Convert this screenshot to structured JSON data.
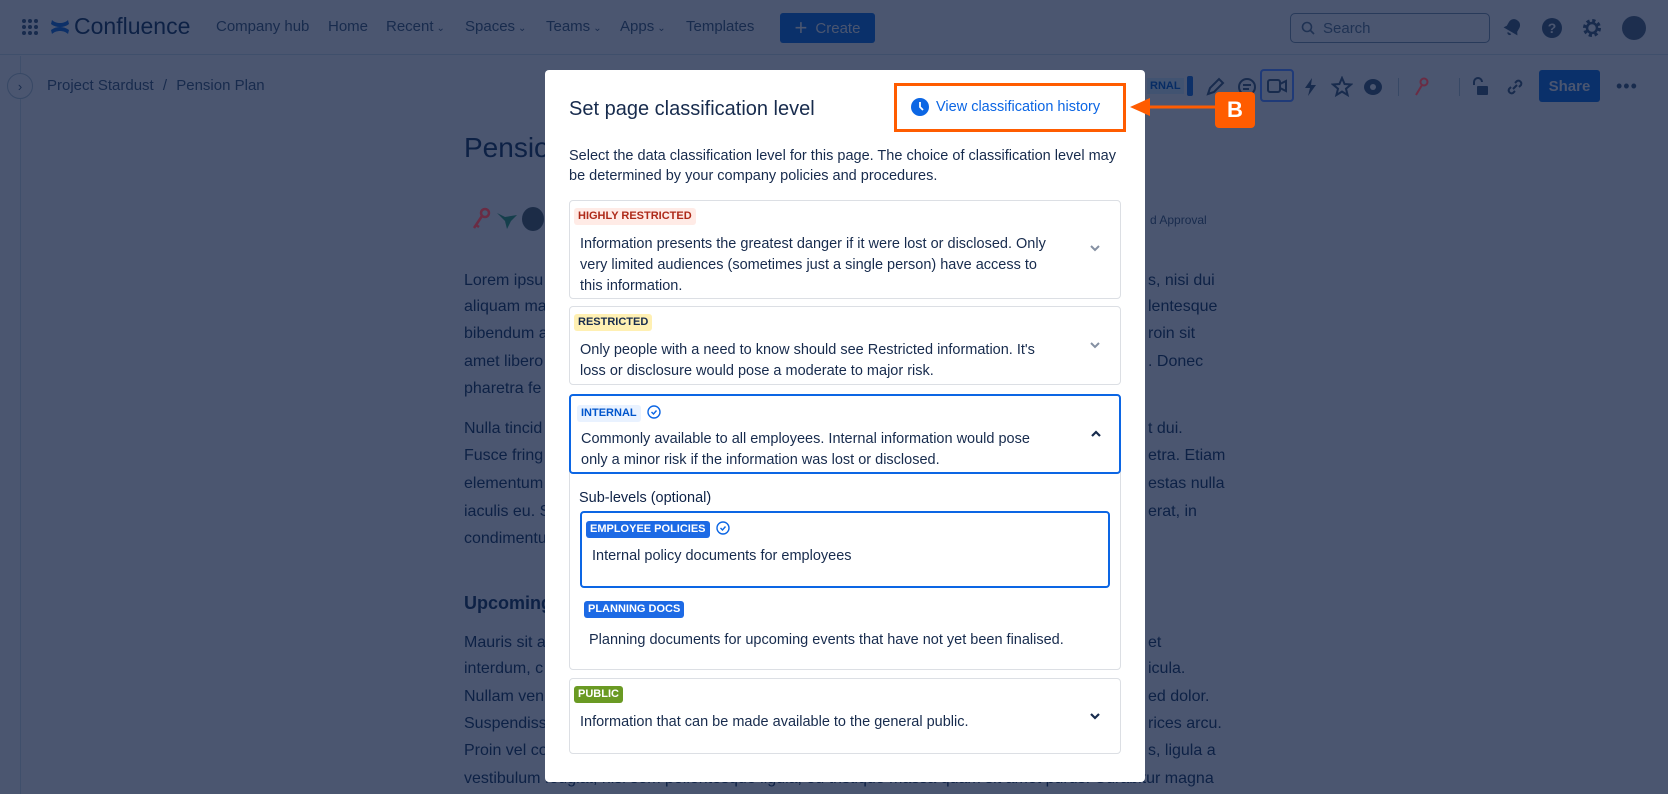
{
  "nav": {
    "app_name": "Confluence",
    "items": [
      {
        "label": "Company hub",
        "dropdown": false
      },
      {
        "label": "Home",
        "dropdown": false
      },
      {
        "label": "Recent",
        "dropdown": true
      },
      {
        "label": "Spaces",
        "dropdown": true
      },
      {
        "label": "Teams",
        "dropdown": true
      },
      {
        "label": "Apps",
        "dropdown": true
      },
      {
        "label": "Templates",
        "dropdown": false
      }
    ],
    "create_label": "Create",
    "search_placeholder": "Search"
  },
  "breadcrumb": {
    "space": "Project Stardust",
    "separator": "/",
    "page": "Pension Plan"
  },
  "toolbar": {
    "classification_fragment": "RNAL",
    "share_label": "Share"
  },
  "page": {
    "title_fragment": "Pensio",
    "byline_fragment": "d Approval",
    "heading_fragment": "Upcoming",
    "lines": [
      {
        "left": "Lorem ipsu",
        "right": "s, nisi dui"
      },
      {
        "left": "aliquam ma",
        "right": "lentesque"
      },
      {
        "left": "bibendum a",
        "right": "roin sit"
      },
      {
        "left": "amet libero",
        "right": ". Donec"
      },
      {
        "left": "pharetra fe",
        "right": ""
      },
      {
        "left": "Nulla tincid",
        "right": "t dui."
      },
      {
        "left": "Fusce fring",
        "right": "etra. Etiam"
      },
      {
        "left": "elementum",
        "right": "estas nulla"
      },
      {
        "left": "iaculis eu. S",
        "right": "erat, in"
      },
      {
        "left": "condimentu",
        "right": ""
      },
      {
        "left": "Mauris sit a",
        "right": "et"
      },
      {
        "left": "interdum, c",
        "right": "icula."
      },
      {
        "left": "Nullam ven",
        "right": "ed dolor."
      },
      {
        "left": "Suspendiss",
        "right": "rices arcu."
      },
      {
        "left": "Proin vel co",
        "right": "s, ligula a"
      },
      {
        "left": "vestibulum feugiat, nisi sem pellentesque ligula, eu tristique massa quam sit amet purus. Curabitur magna",
        "right": ""
      }
    ]
  },
  "modal": {
    "title": "Set page classification level",
    "history_link": "View classification history",
    "description": "Select the data classification level for this page. The choice of classification level may be determined by your company policies and procedures.",
    "levels": [
      {
        "label": "Highly restricted",
        "description": "Information presents the greatest danger if it were lost or disclosed. Only very limited audiences (sometimes just a single person) have access to this information.",
        "color": "#ae2a19",
        "bg": "#ffebe6",
        "selected": false,
        "expanded": false
      },
      {
        "label": "Restricted",
        "description": "Only people with a need to know should see Restricted information. It's loss or disclosure would pose a moderate to major risk.",
        "color": "#172b4d",
        "bg": "#fff0b3",
        "selected": false,
        "expanded": false
      },
      {
        "label": "Internal",
        "description": "Commonly available to all employees. Internal information would pose only a minor risk if the information was lost or disclosed.",
        "color": "#0055cc",
        "bg": "#e9f2ff",
        "selected": true,
        "expanded": true
      },
      {
        "label": "Public",
        "description": "Information that can be made available to the general public.",
        "color": "#ffffff",
        "bg": "#6a9a23",
        "selected": false,
        "expanded": false
      }
    ],
    "sublevels_label": "Sub-levels (optional)",
    "sublevels": [
      {
        "label": "Employee policies",
        "description": "Internal policy documents for employees",
        "selected": true
      },
      {
        "label": "Planning docs",
        "description": "Planning documents for upcoming events that have not yet been finalised.",
        "selected": false
      }
    ]
  },
  "annotation": {
    "label": "B",
    "color": "#ff5c00"
  }
}
